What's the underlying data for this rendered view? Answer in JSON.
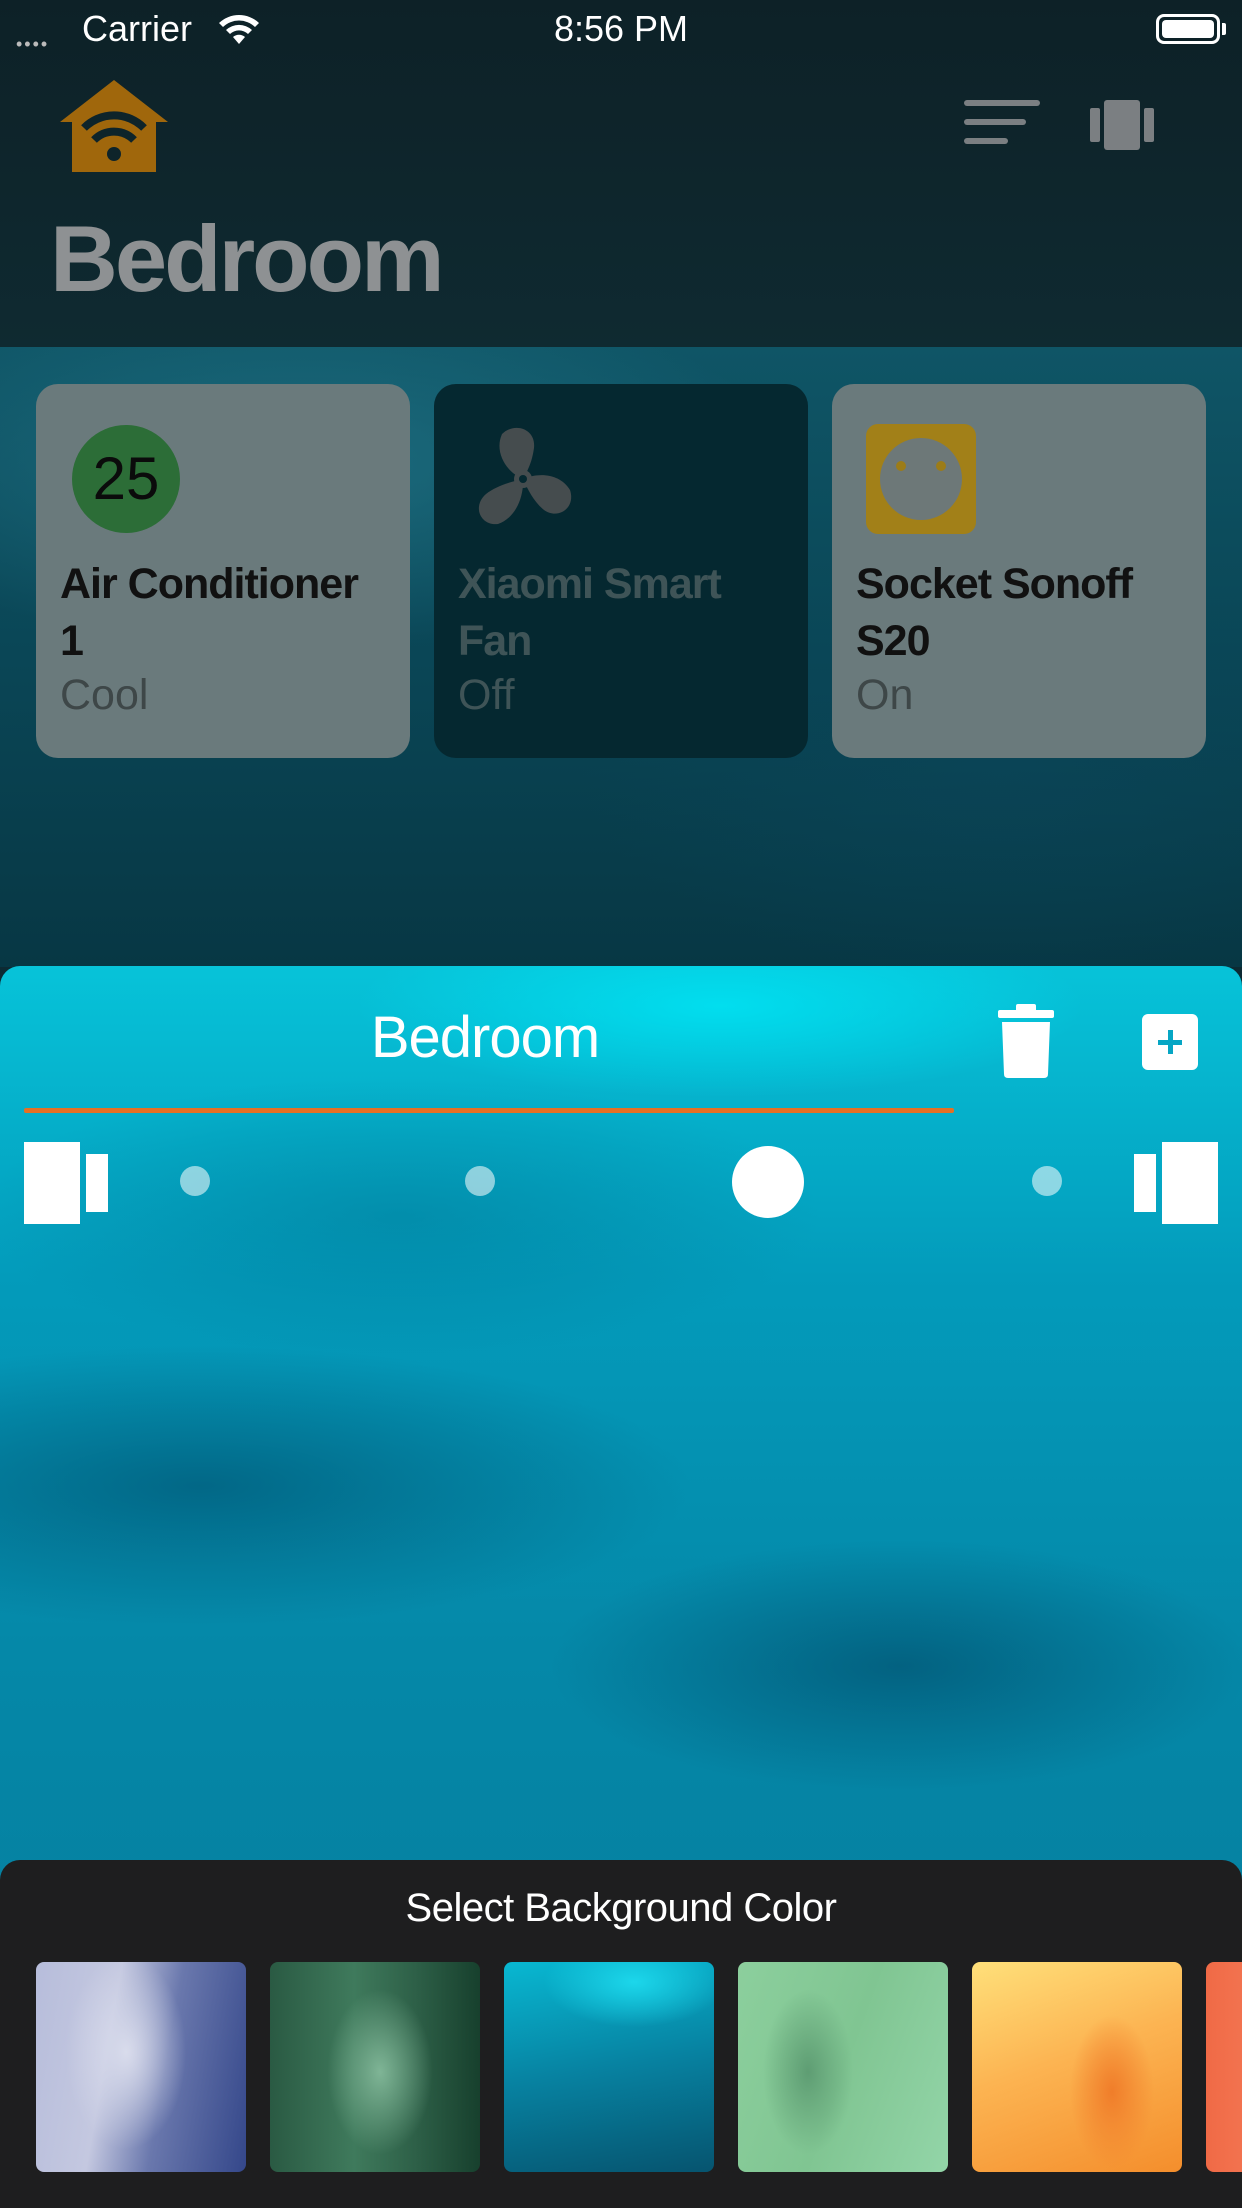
{
  "status_bar": {
    "signal": "••••",
    "carrier": "Carrier",
    "time": "8:56 PM"
  },
  "header": {
    "title": "Bedroom",
    "icons": [
      "home-wifi-icon",
      "sort-icon",
      "layout-icon"
    ]
  },
  "devices": [
    {
      "name": "Air Conditioner 1",
      "state": "Cool",
      "badge": "25",
      "icon": "thermostat-badge",
      "active": true
    },
    {
      "name": "Xiaomi Smart Fan",
      "state": "Off",
      "icon": "fan-icon",
      "active": false
    },
    {
      "name": "Socket Sonoff S20",
      "state": "On",
      "icon": "socket-icon",
      "active": true
    }
  ],
  "editor": {
    "room_name": "Bedroom",
    "accent_color": "#e67024",
    "icons": [
      "trash-icon",
      "add-icon",
      "align-left-icon",
      "align-right-icon"
    ],
    "page_dots": 5,
    "active_dot": 3
  },
  "background_picker": {
    "title": "Select Background Color",
    "swatches": [
      "blue-cloud",
      "dark-green",
      "teal",
      "light-green",
      "orange",
      "coral"
    ]
  }
}
